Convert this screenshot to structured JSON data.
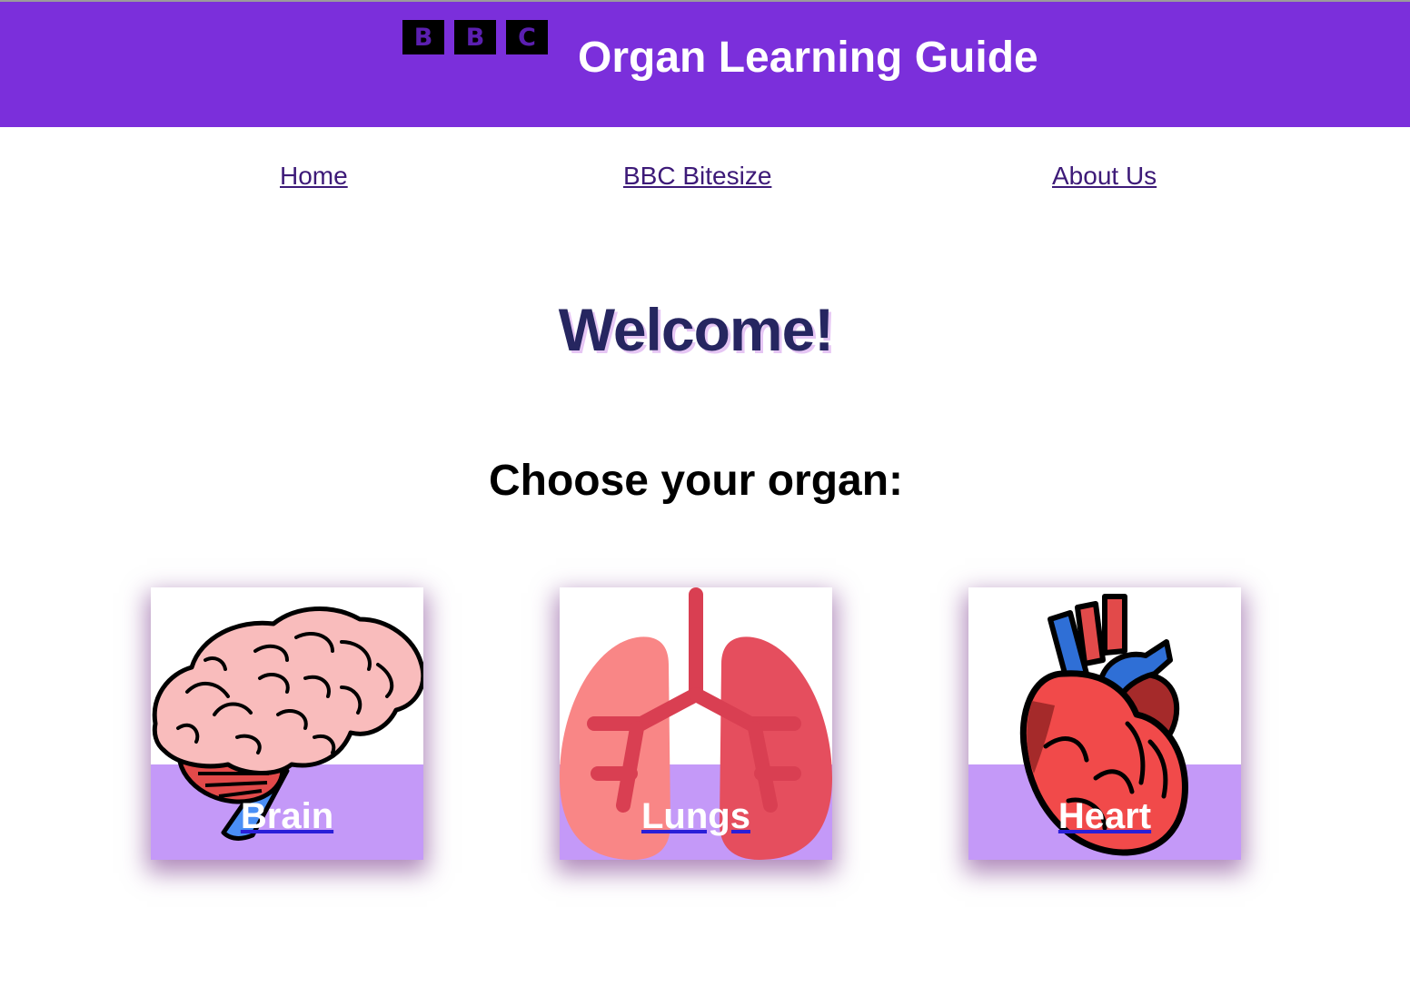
{
  "header": {
    "logo_letters": [
      "B",
      "B",
      "C"
    ],
    "title": "Organ Learning Guide",
    "background": "#7b2fdb"
  },
  "nav": {
    "items": [
      {
        "label": "Home"
      },
      {
        "label": "BBC Bitesize"
      },
      {
        "label": "About Us"
      }
    ]
  },
  "main": {
    "welcome": "Welcome!",
    "prompt": "Choose your organ:"
  },
  "organs": [
    {
      "label": "Brain",
      "icon": "brain-icon"
    },
    {
      "label": "Lungs",
      "icon": "lungs-icon"
    },
    {
      "label": "Heart",
      "icon": "heart-icon"
    }
  ],
  "colors": {
    "accent": "#7b2fdb",
    "card_band": "#c499f8",
    "heading": "#262660",
    "link": "#3d1a78"
  }
}
